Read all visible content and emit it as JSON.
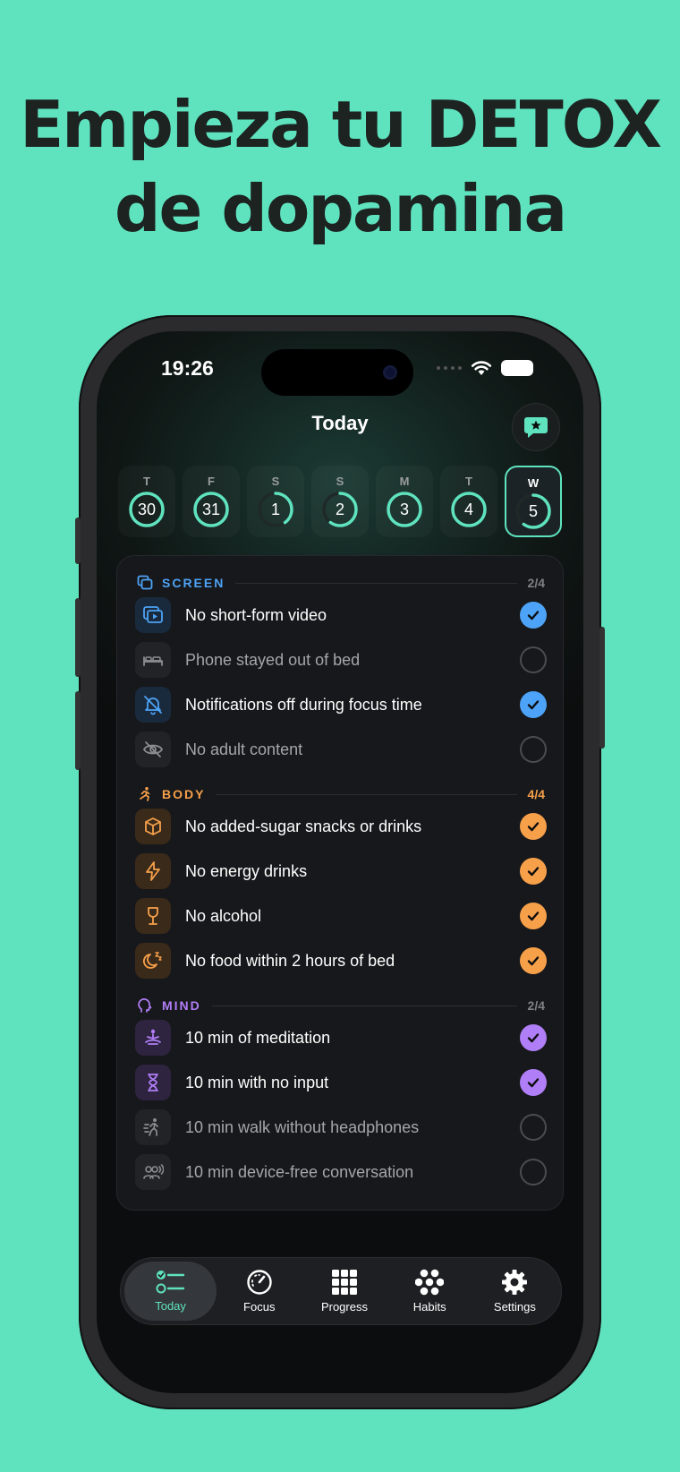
{
  "headline": {
    "line1": "Empieza tu DETOX",
    "line2": "de dopamina"
  },
  "status": {
    "time": "19:26"
  },
  "nav": {
    "title": "Today"
  },
  "colors": {
    "accent": "#5fe3bf",
    "screen": "#4da3f7",
    "body": "#f7a04a",
    "mind": "#b07ef7"
  },
  "days": [
    {
      "letter": "T",
      "num": "30",
      "progress": 1.0
    },
    {
      "letter": "F",
      "num": "31",
      "progress": 1.0
    },
    {
      "letter": "S",
      "num": "1",
      "progress": 0.4
    },
    {
      "letter": "S",
      "num": "2",
      "progress": 0.6
    },
    {
      "letter": "M",
      "num": "3",
      "progress": 1.0
    },
    {
      "letter": "T",
      "num": "4",
      "progress": 1.0
    },
    {
      "letter": "W",
      "num": "5",
      "progress": 0.6,
      "active": true
    }
  ],
  "sections": {
    "screen": {
      "label": "SCREEN",
      "count": "2/4",
      "items": [
        {
          "label": "No short-form video",
          "done": true,
          "icon": "video-icon"
        },
        {
          "label": "Phone stayed out of bed",
          "done": false,
          "icon": "bed-icon"
        },
        {
          "label": "Notifications off during focus time",
          "done": true,
          "icon": "bell-off-icon"
        },
        {
          "label": "No adult content",
          "done": false,
          "icon": "eye-off-icon"
        }
      ]
    },
    "body": {
      "label": "BODY",
      "count": "4/4",
      "items": [
        {
          "label": "No added-sugar snacks or drinks",
          "done": true,
          "icon": "box-icon"
        },
        {
          "label": "No energy drinks",
          "done": true,
          "icon": "bolt-icon"
        },
        {
          "label": "No alcohol",
          "done": true,
          "icon": "wine-glass-icon"
        },
        {
          "label": "No food within 2 hours of bed",
          "done": true,
          "icon": "moon-icon"
        }
      ]
    },
    "mind": {
      "label": "MIND",
      "count": "2/4",
      "items": [
        {
          "label": "10 min of meditation",
          "done": true,
          "icon": "meditation-icon"
        },
        {
          "label": "10 min with no input",
          "done": true,
          "icon": "hourglass-icon"
        },
        {
          "label": "10 min walk without headphones",
          "done": false,
          "icon": "walking-icon"
        },
        {
          "label": "10 min device-free conversation",
          "done": false,
          "icon": "people-talking-icon"
        }
      ]
    }
  },
  "tabs": [
    {
      "label": "Today",
      "icon": "checklist-icon",
      "active": true
    },
    {
      "label": "Focus",
      "icon": "gauge-icon"
    },
    {
      "label": "Progress",
      "icon": "grid-icon"
    },
    {
      "label": "Habits",
      "icon": "flower-icon"
    },
    {
      "label": "Settings",
      "icon": "gear-icon"
    }
  ]
}
